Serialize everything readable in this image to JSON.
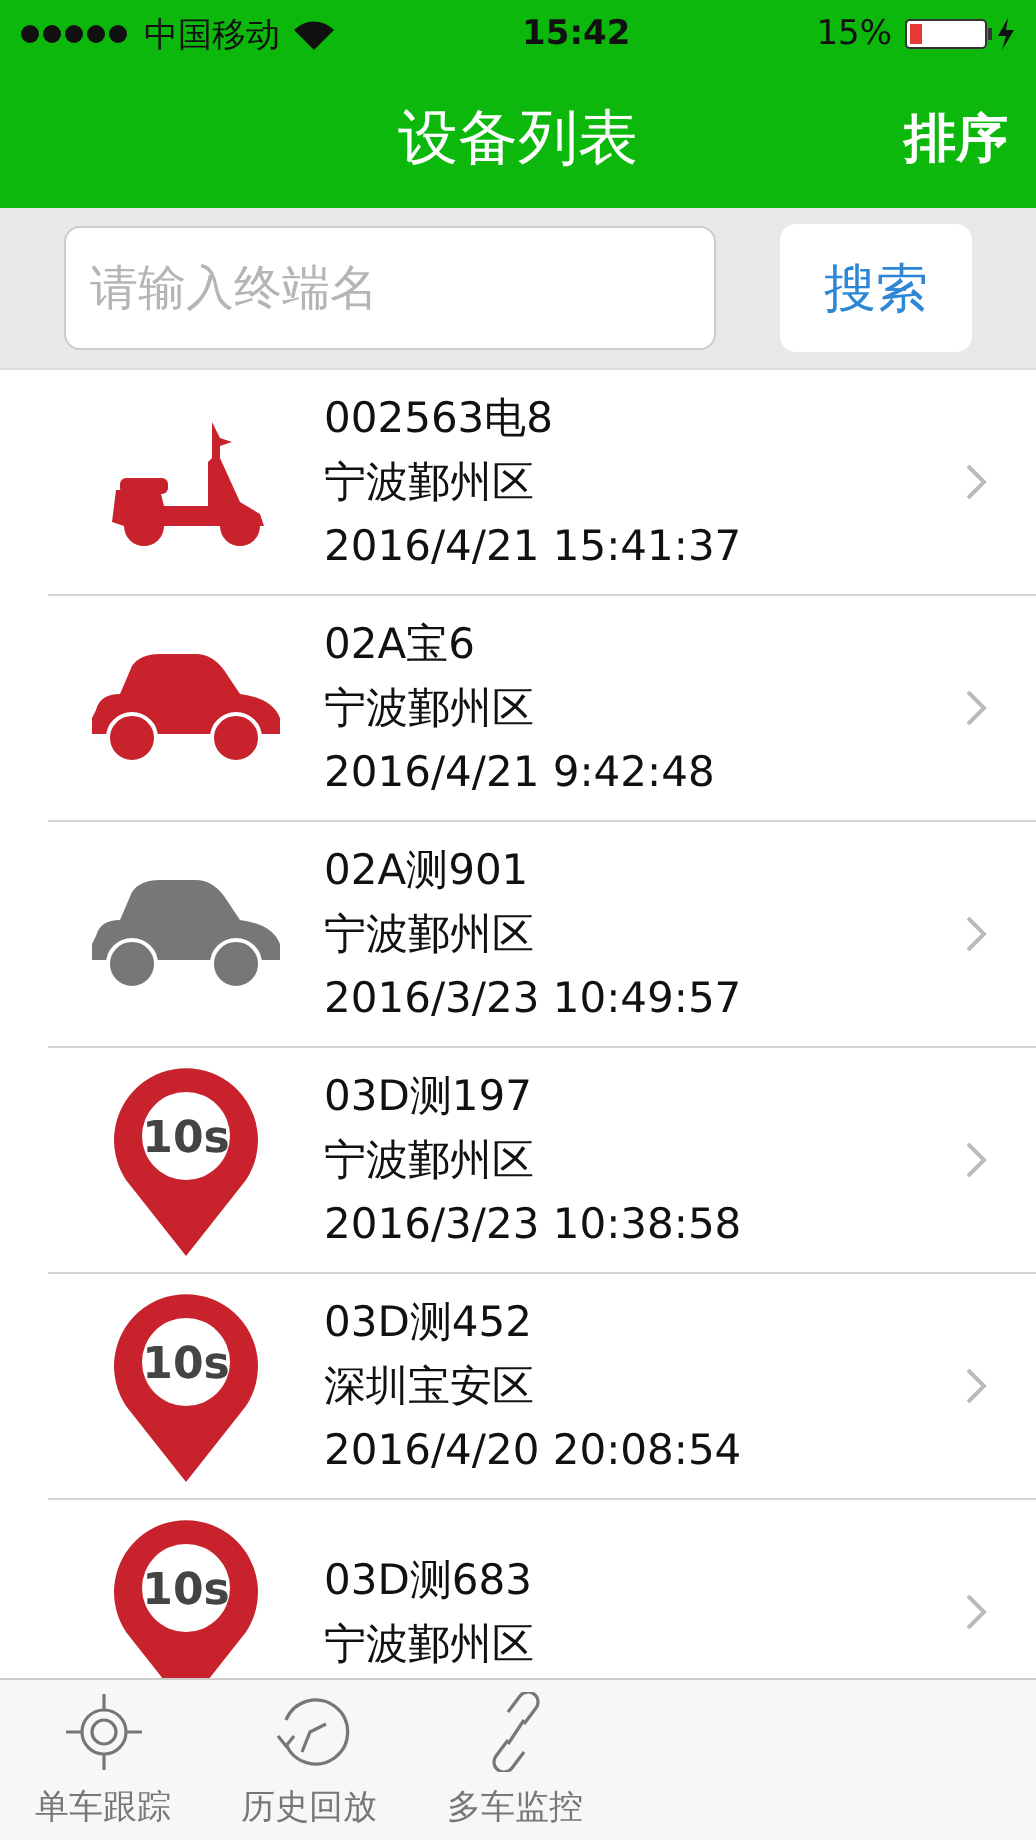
{
  "status_bar": {
    "carrier": "中国移动",
    "time": "15:42",
    "battery": "15%"
  },
  "nav": {
    "title": "设备列表",
    "action": "排序"
  },
  "search": {
    "placeholder": "请输入终端名",
    "button": "搜索"
  },
  "devices": [
    {
      "kind": "scooter",
      "color": "#c8232c",
      "name": "002563电8",
      "location": "宁波鄞州区",
      "time": "2016/4/21 15:41:37"
    },
    {
      "kind": "car",
      "color": "#c8232c",
      "name": "02A宝6",
      "location": "宁波鄞州区",
      "time": "2016/4/21 9:42:48"
    },
    {
      "kind": "car",
      "color": "#777777",
      "name": "02A测901",
      "location": "宁波鄞州区",
      "time": "2016/3/23 10:49:57"
    },
    {
      "kind": "pin",
      "color": "#c8232c",
      "badge": "10s",
      "name": "03D测197",
      "location": "宁波鄞州区",
      "time": "2016/3/23 10:38:58"
    },
    {
      "kind": "pin",
      "color": "#c8232c",
      "badge": "10s",
      "name": "03D测452",
      "location": "深圳宝安区",
      "time": "2016/4/20 20:08:54"
    },
    {
      "kind": "pin",
      "color": "#c8232c",
      "badge": "10s",
      "name": "03D测683",
      "location": "宁波鄞州区"
    }
  ],
  "tabs": [
    {
      "kind": "target",
      "label": "单车跟踪"
    },
    {
      "kind": "history",
      "label": "历史回放"
    },
    {
      "kind": "link",
      "label": "多车监控"
    }
  ]
}
